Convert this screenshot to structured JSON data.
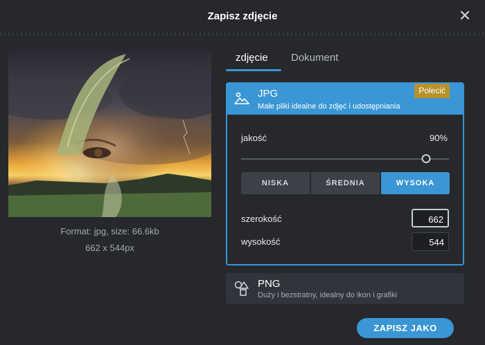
{
  "dialog": {
    "title": "Zapisz zdjęcie"
  },
  "preview": {
    "format_text": "Format: jpg, size: 66.6kb",
    "dimensions_text": "662 x 544px"
  },
  "tabs": [
    {
      "label": "zdjęcie",
      "active": true
    },
    {
      "label": "Dokument",
      "active": false
    }
  ],
  "jpg": {
    "name": "JPG",
    "description": "Małe pliki idealne do zdjęć i udostępniania",
    "badge": "Polecić",
    "icon": "image-mountain-icon",
    "quality_label": "jakość",
    "quality_value": "90%",
    "quality_fraction": 0.89,
    "presets": [
      "NISKA",
      "ŚREDNIA",
      "WYSOKA"
    ],
    "selected_preset": "WYSOKA",
    "width_label": "szerokość",
    "width_value": "662",
    "height_label": "wysokość",
    "height_value": "544"
  },
  "png": {
    "name": "PNG",
    "description": "Duży i bezstratny, idealny do ikon i grafiki",
    "icon": "shapes-icon"
  },
  "actions": {
    "save_as": "ZAPISZ JAKO"
  },
  "colors": {
    "accent": "#3a96d4",
    "badge": "#b7922c",
    "background": "#26282c"
  }
}
